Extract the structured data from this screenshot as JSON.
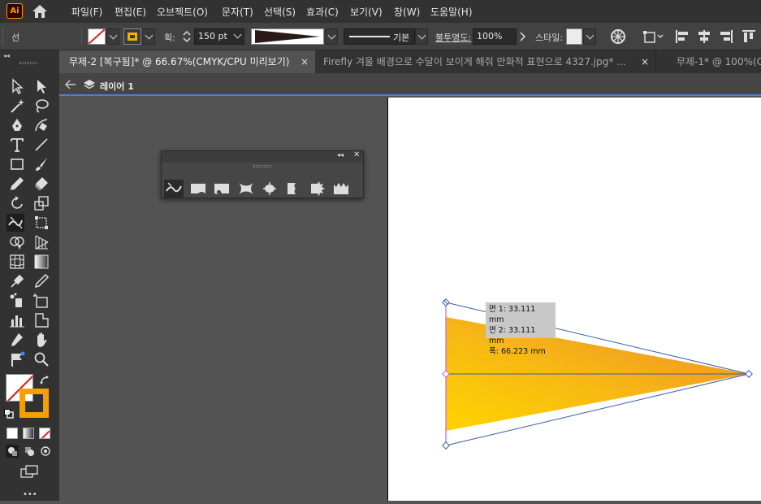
{
  "app": {
    "logo": "Ai"
  },
  "menu": [
    "파일(F)",
    "편집(E)",
    "오브젝트(O)",
    "문자(T)",
    "선택(S)",
    "효과(C)",
    "보기(V)",
    "창(W)",
    "도움말(H)"
  ],
  "control": {
    "selection_label": "선",
    "stroke_weight_label": "획:",
    "stroke_weight_value": "150 pt",
    "stroke_style_label": "기본",
    "opacity_label": "불투명도:",
    "opacity_value": "100%",
    "style_label": "스타일:"
  },
  "tabs": [
    {
      "label": "무제-2 [복구됨]* @ 66.67%(CMYK/CPU 미리보기)",
      "close": "×"
    },
    {
      "label": "Firefly 겨울 배경으로 수달이 보이게 해줘 만화적 표현으로 4327.jpg* ...",
      "close": "×"
    },
    {
      "label": "무제-1* @ 100%(C"
    }
  ],
  "breadcrumb": {
    "layer": "레이어 1"
  },
  "tooltip": {
    "line1": "면 1: 33.111 mm",
    "line2": "면 2: 33.111 mm",
    "line3": "폭:  66.223 mm"
  },
  "colors": {
    "accent_blue": "#4a7fd1",
    "gradient_start": "#ffd000",
    "gradient_end": "#f08c28",
    "path_magenta": "#d65ad6"
  },
  "icons": {
    "tools": [
      "selection-icon",
      "direct-selection-icon",
      "magic-wand-icon",
      "lasso-icon",
      "pen-icon",
      "curvature-icon",
      "type-icon",
      "line-icon",
      "rectangle-icon",
      "paintbrush-icon",
      "pencil-icon",
      "eraser-icon",
      "rotate-icon",
      "scale-icon",
      "width-tool-icon",
      "free-transform-icon",
      "shape-builder-icon",
      "perspective-grid-icon",
      "mesh-icon",
      "gradient-icon",
      "eyedropper-icon",
      "blend-icon",
      "symbol-sprayer-icon",
      "artboard-icon",
      "graph-icon",
      "slice-icon",
      "hand-icon",
      "zoom-icon"
    ],
    "width_panel": [
      "width-tool-icon",
      "warp-icon",
      "twirl-icon",
      "pucker-icon",
      "bloat-icon",
      "scallop-icon",
      "crystallize-icon",
      "wrinkle-icon"
    ]
  }
}
